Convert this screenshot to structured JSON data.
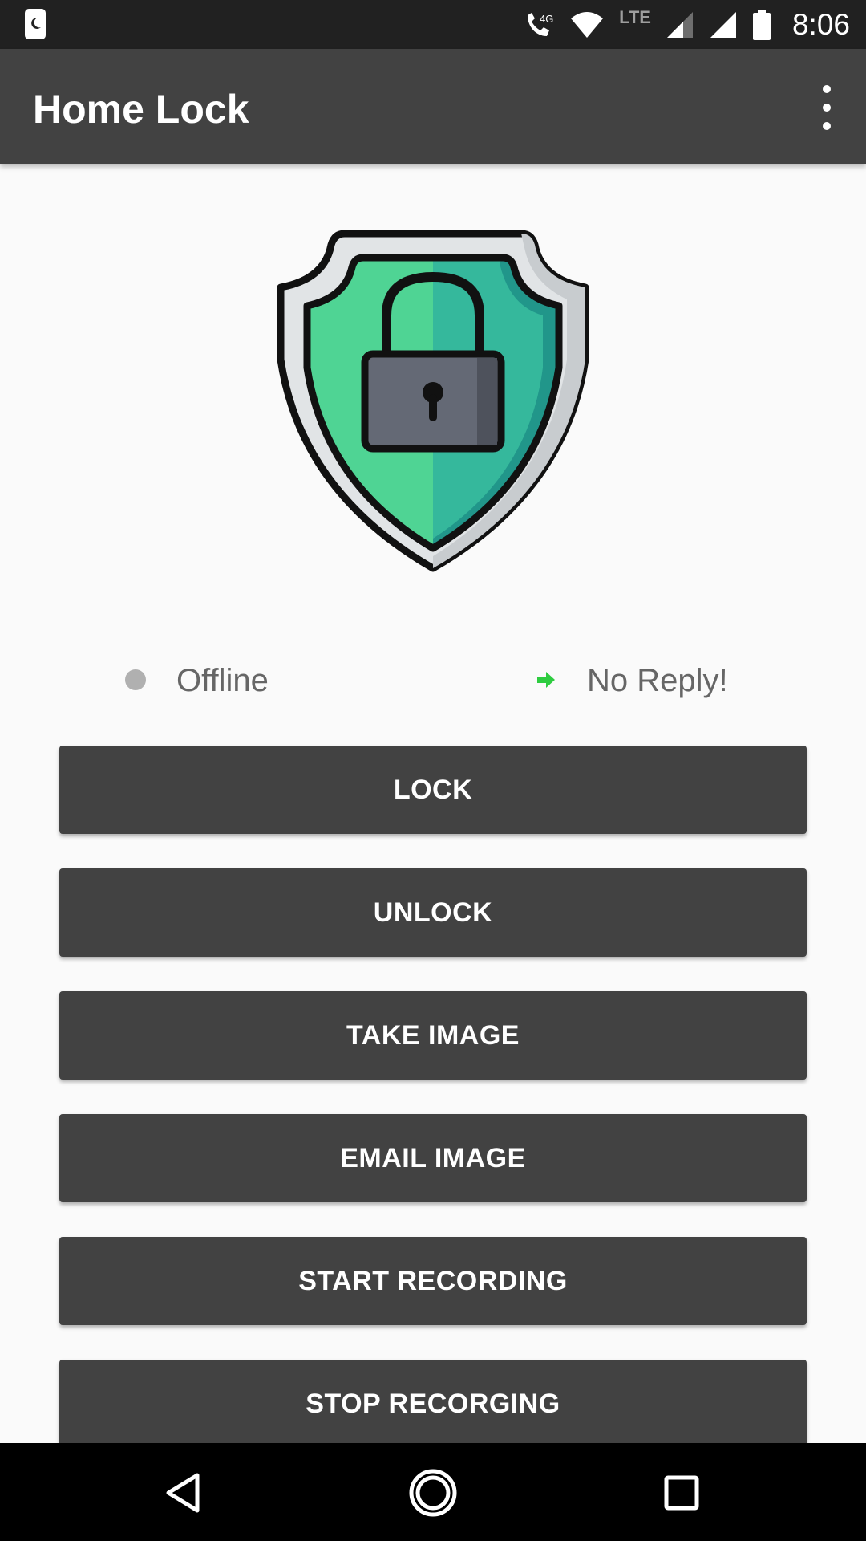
{
  "status_bar": {
    "time": "8:06",
    "network_label": "LTE",
    "call_badge": "4G",
    "icons": [
      "notification-icon",
      "wifi-call-icon",
      "wifi-icon",
      "signal-icon",
      "signal-icon-2",
      "battery-icon"
    ]
  },
  "app_bar": {
    "title": "Home Lock",
    "menu_icon": "more-vert-icon"
  },
  "logo": {
    "icon": "shield-lock-icon",
    "colors": {
      "shield_left": "#4fd494",
      "shield_right": "#35b89c",
      "shield_rim": "#e1e4e6",
      "lock_body": "#646975",
      "outline": "#111111"
    }
  },
  "status_row": {
    "connection_label": "Offline",
    "connection_dot_color": "#b0b0b0",
    "reply_label": "No Reply!",
    "reply_arrow_color": "#2ecc40"
  },
  "buttons": [
    {
      "label": "LOCK"
    },
    {
      "label": "UNLOCK"
    },
    {
      "label": "TAKE IMAGE"
    },
    {
      "label": "EMAIL IMAGE"
    },
    {
      "label": "START RECORDING"
    },
    {
      "label": "STOP RECORGING"
    }
  ],
  "nav_bar": {
    "icons": [
      "back-icon",
      "home-icon",
      "recents-icon"
    ]
  },
  "theme": {
    "primary": "#424242",
    "status_bar": "#212121",
    "background": "#fafafa"
  }
}
